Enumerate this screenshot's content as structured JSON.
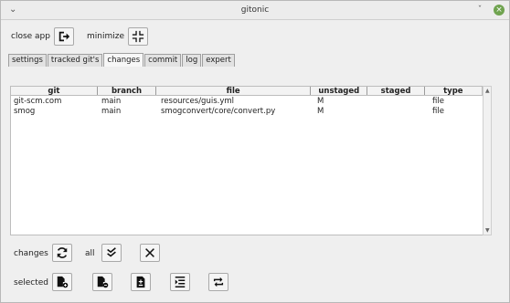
{
  "window": {
    "title": "gitonic",
    "menu_icon": "chevron-down-icon",
    "minimize_glyph": "ˇ",
    "maximize_glyph": "▫",
    "close_glyph": "×"
  },
  "toolbar": {
    "close_app_label": "close app",
    "close_app_icon": "exit-icon",
    "minimize_label": "minimize",
    "minimize_icon": "compress-icon"
  },
  "tabs": [
    {
      "label": "settings",
      "active": false
    },
    {
      "label": "tracked git's",
      "active": false
    },
    {
      "label": "changes",
      "active": true
    },
    {
      "label": "commit",
      "active": false
    },
    {
      "label": "log",
      "active": false
    },
    {
      "label": "expert",
      "active": false
    }
  ],
  "table": {
    "columns": [
      "git",
      "branch",
      "file",
      "unstaged",
      "staged",
      "type"
    ],
    "rows": [
      {
        "git": "git-scm.com",
        "branch": "main",
        "file": "resources/guis.yml",
        "unstaged": "M",
        "staged": "",
        "type": "file"
      },
      {
        "git": "smog",
        "branch": "main",
        "file": "smogconvert/core/convert.py",
        "unstaged": "M",
        "staged": "",
        "type": "file"
      }
    ]
  },
  "changes_bar": {
    "changes_label": "changes",
    "refresh_icon": "refresh-icon",
    "all_label": "all",
    "select_all_icon": "double-check-icon",
    "clear_icon": "close-x-icon"
  },
  "selected_bar": {
    "selected_label": "selected",
    "buttons": [
      "file-add-icon",
      "file-remove-icon",
      "file-diff-icon",
      "indent-icon",
      "sync-icon"
    ]
  }
}
